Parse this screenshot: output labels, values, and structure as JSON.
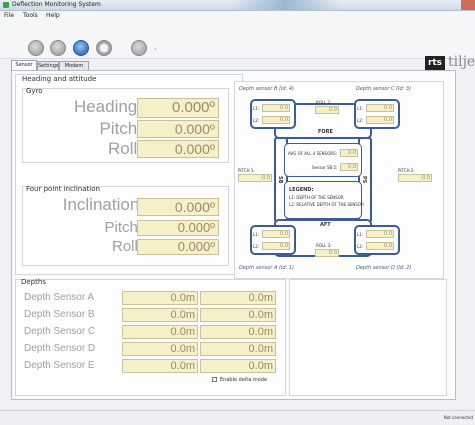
{
  "window": {
    "title": "Deflection Monitoring System",
    "right_text": "",
    "status": "Not connected"
  },
  "menu": [
    "File",
    "Tools",
    "Help"
  ],
  "logo": {
    "mark": "rts",
    "text": "tilje"
  },
  "tabs": [
    "Sensor data",
    "Settings",
    "Modem Control"
  ],
  "heading_attitude": {
    "title": "Heading and attitude",
    "gyro": {
      "title": "Gyro",
      "rows": [
        {
          "label": "Heading:",
          "value": "0.000º"
        },
        {
          "label": "Pitch:",
          "value": "0.000º"
        },
        {
          "label": "Roll:",
          "value": "0.000º"
        }
      ]
    },
    "four_point": {
      "title": "Four point inclination",
      "rows": [
        {
          "label": "Inclination:",
          "value": "0.000º"
        },
        {
          "label": "Pitch:",
          "value": "0.000º"
        },
        {
          "label": "Roll:",
          "value": "0.000º"
        }
      ]
    }
  },
  "diagram": {
    "sensor_b": "Depth sensor B (Id: 4)",
    "sensor_c": "Depth sensor C (Id: 3)",
    "sensor_a": "Depth sensor A (Id: 1)",
    "sensor_d": "Depth sensor D (Id: 2)",
    "fore": "FORE",
    "aft": "AFT",
    "sb": "SB",
    "ps": "PS",
    "l1": "L1:",
    "l2": "L2:",
    "zero": "0.0",
    "roll1": "ROLL 1:",
    "roll3": "ROLL 3:",
    "pitch1": "PITCH 1:",
    "pitch2": "PITCH 2:",
    "avg_label": "AVG OF ALL 4 SENSORS:",
    "sensor_sb": "Sensor SB 5:",
    "legend_title": "LEGEND:",
    "legend_l1": "L1: DEPTH OF THE SENSOR",
    "legend_l2": "L2: RELATIVE DEPTH OF THE SENSOR"
  },
  "depths": {
    "title": "Depths",
    "rows": [
      {
        "label": "Depth Sensor A",
        "v1": "0.0m",
        "v2": "0.0m"
      },
      {
        "label": "Depth Sensor B",
        "v1": "0.0m",
        "v2": "0.0m"
      },
      {
        "label": "Depth Sensor C",
        "v1": "0.0m",
        "v2": "0.0m"
      },
      {
        "label": "Depth Sensor D",
        "v1": "0.0m",
        "v2": "0.0m"
      },
      {
        "label": "Depth Sensor E",
        "v1": "0.0m",
        "v2": "0.0m"
      }
    ],
    "delta_label": "Enable delta mode"
  }
}
